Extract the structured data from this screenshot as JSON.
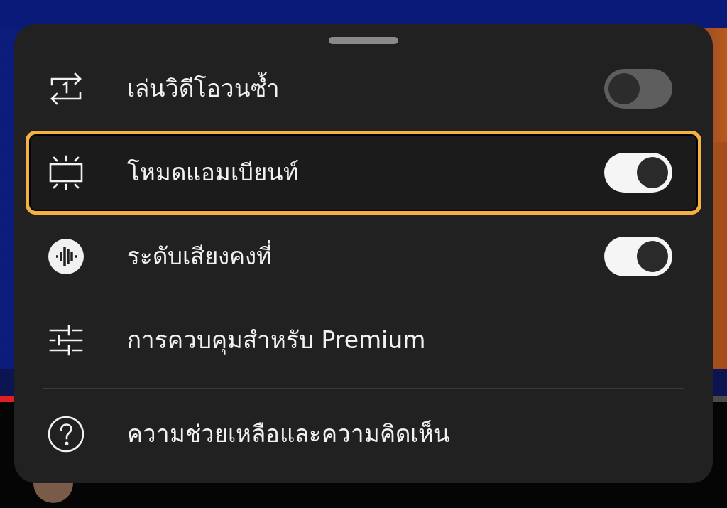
{
  "sheet": {
    "items": [
      {
        "kind": "toggle",
        "label": "เล่นวิดีโอวนซ้ำ",
        "on": false,
        "highlighted": false
      },
      {
        "kind": "toggle",
        "label": "โหมดแอมเบียนท์",
        "on": true,
        "highlighted": true
      },
      {
        "kind": "toggle",
        "label": "ระดับเสียงคงที่",
        "on": true,
        "highlighted": false
      },
      {
        "kind": "link",
        "label": "การควบคุมสำหรับ Premium",
        "highlighted": false
      }
    ],
    "footer_items": [
      {
        "kind": "link",
        "label": "ความช่วยเหลือและความคิดเห็น",
        "highlighted": false
      }
    ]
  }
}
